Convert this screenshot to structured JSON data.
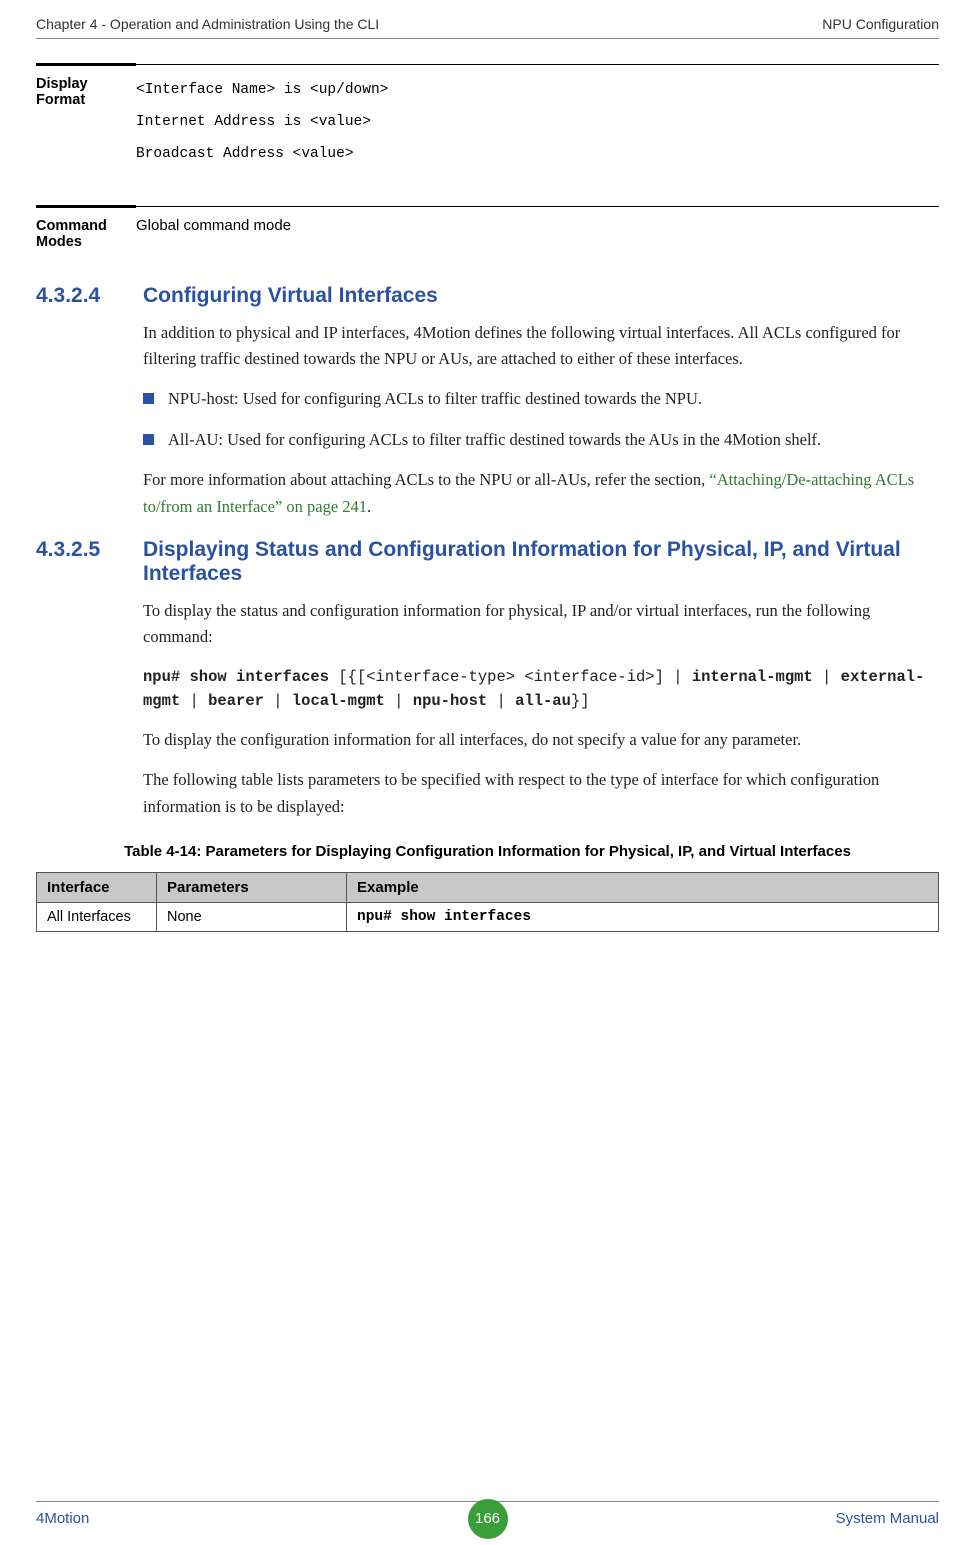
{
  "header": {
    "left": "Chapter 4 - Operation and Administration Using the CLI",
    "right": "NPU Configuration"
  },
  "defs": [
    {
      "label": "Display Format",
      "lines": [
        "<Interface Name> is <up/down>",
        "Internet Address is <value>",
        "Broadcast Address  <value>"
      ],
      "mono": true
    },
    {
      "label": "Command Modes",
      "lines": [
        "Global command mode"
      ],
      "mono": false
    }
  ],
  "section1": {
    "num": "4.3.2.4",
    "title": "Configuring Virtual Interfaces",
    "para1": "In addition to physical and IP interfaces, 4Motion defines the following virtual interfaces. All ACLs configured for filtering traffic destined towards the NPU or AUs, are attached to either of these interfaces.",
    "bullets": [
      "NPU-host: Used for configuring ACLs to filter traffic destined towards the NPU.",
      "All-AU: Used for configuring ACLs to filter traffic destined towards the AUs in the 4Motion shelf."
    ],
    "para2_pre": "For more information about attaching ACLs to the NPU or all-AUs, refer the section, ",
    "para2_link": "“Attaching/De-attaching ACLs to/from an Interface” on page 241",
    "para2_post": "."
  },
  "section2": {
    "num": "4.3.2.5",
    "title": "Displaying Status and Configuration Information for Physical, IP, and Virtual Interfaces",
    "para1": "To display the status and configuration information for physical, IP and/or virtual interfaces, run the following command:",
    "command": "npu# show interfaces [{[<interface-type> <interface-id>] | internal-mgmt | external-mgmt | bearer | local-mgmt | npu-host | all-au}]",
    "para2": "To display the configuration information for all interfaces, do not specify a value for any parameter.",
    "para3": "The following table lists parameters to be specified with respect to the type of interface for which configuration information is to be displayed:"
  },
  "table": {
    "caption": "Table 4-14: Parameters for Displaying Configuration Information for Physical, IP, and Virtual Interfaces",
    "headers": [
      "Interface",
      "Parameters",
      "Example"
    ],
    "rows": [
      [
        "All Interfaces",
        "None",
        "npu# show interfaces"
      ]
    ]
  },
  "footer": {
    "left": "4Motion",
    "page": "166",
    "right": "System Manual"
  }
}
